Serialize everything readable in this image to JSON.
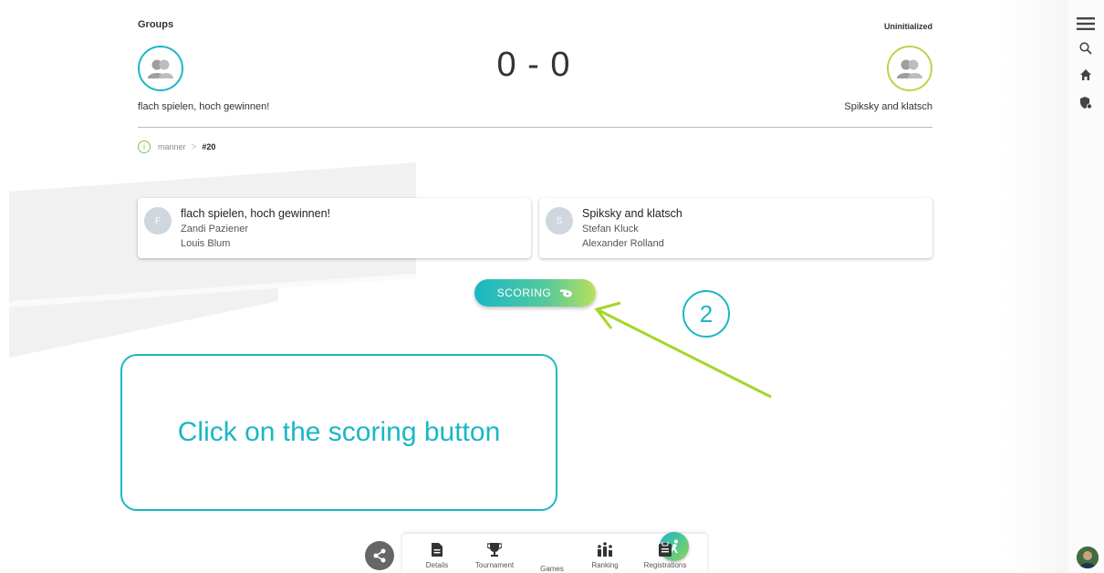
{
  "header": {
    "left_label": "Groups",
    "right_label": "Uninitialized"
  },
  "match": {
    "score": "0 - 0",
    "team_left": "flach spielen, hoch gewinnen!",
    "team_right": "Spiksky and klatsch"
  },
  "breadcrumb": {
    "info_glyph": "i",
    "category": "manner",
    "separator": ">",
    "current": "#20"
  },
  "cards": [
    {
      "initial": "F",
      "team": "flach spielen, hoch gewinnen!",
      "player1": "Zandi Paziener",
      "player2": "Louis Blum"
    },
    {
      "initial": "S",
      "team": "Spiksky and klatsch",
      "player1": "Stefan Kluck",
      "player2": "Alexander Rolland"
    }
  ],
  "scoring_button": {
    "label": "SCORING",
    "icon": "whistle-icon"
  },
  "tutorial": {
    "step": "2",
    "callout_text": "Click on the scoring button"
  },
  "bottom_nav": [
    {
      "label": "Details",
      "icon": "document-icon"
    },
    {
      "label": "Tournament",
      "icon": "trophy-icon"
    },
    {
      "label": "Games",
      "icon": "player-icon",
      "active": true
    },
    {
      "label": "Ranking",
      "icon": "ranking-icon"
    },
    {
      "label": "Registrations",
      "icon": "clipboard-icon"
    }
  ],
  "right_rail": [
    "menu-icon",
    "search-icon",
    "home-icon",
    "shield-icon"
  ],
  "colors": {
    "accent": "#19b7c6",
    "accent_green": "#b8e15a",
    "arrow": "#a5d62b"
  }
}
